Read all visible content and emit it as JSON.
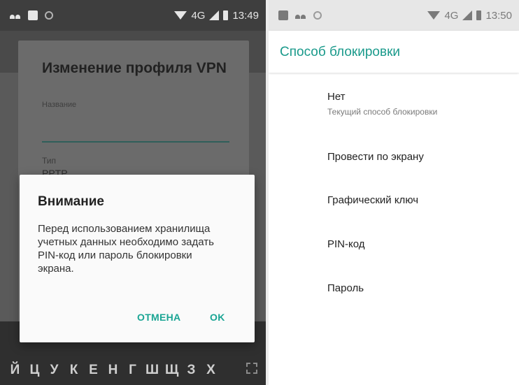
{
  "left": {
    "status_bar": {
      "network": "4G",
      "time": "13:49"
    },
    "vpn_dialog": {
      "title": "Изменение профиля VPN",
      "name_label": "Название",
      "type_label": "Тип",
      "type_value": "PPTP"
    },
    "alert": {
      "title": "Внимание",
      "message": "Перед использованием хранилища учетных данных необходимо задать PIN-код или пароль блокировки экрана.",
      "cancel_label": "ОТМЕНА",
      "ok_label": "OK"
    },
    "keyboard": {
      "row_keys": [
        "Й",
        "Ц",
        "У",
        "К",
        "Е",
        "Н",
        "Г",
        "Ш",
        "Щ",
        "З",
        "Х"
      ]
    }
  },
  "right": {
    "status_bar": {
      "network": "4G",
      "time": "13:50"
    },
    "title": "Способ блокировки",
    "options": [
      {
        "label": "Нет",
        "summary": "Текущий способ блокировки"
      },
      {
        "label": "Провести по экрану"
      },
      {
        "label": "Графический ключ"
      },
      {
        "label": "PIN-код"
      },
      {
        "label": "Пароль"
      }
    ]
  },
  "colors": {
    "accent": "#1aa594",
    "dim_overlay": "#5a5a5a"
  }
}
